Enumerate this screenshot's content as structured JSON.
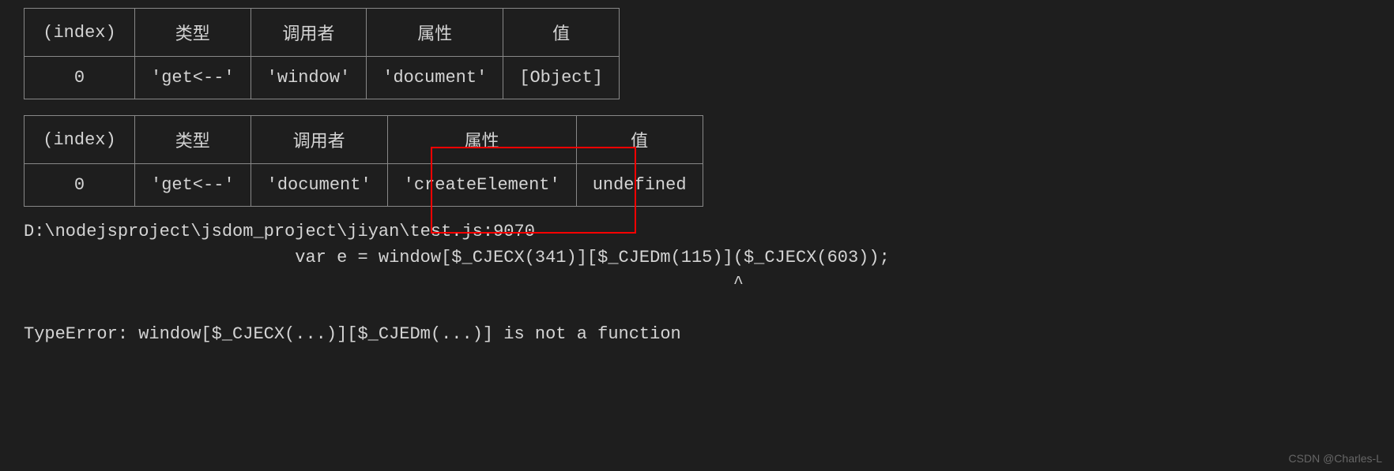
{
  "table1": {
    "headers": [
      "(index)",
      "类型",
      "调用者",
      "属性",
      "值"
    ],
    "row": {
      "index": "0",
      "type": "'get<--'",
      "caller": "'window'",
      "attr": "'document'",
      "value": "[Object]"
    }
  },
  "table2": {
    "headers": [
      "(index)",
      "类型",
      "调用者",
      "属性",
      "值"
    ],
    "row": {
      "index": "0",
      "type": "'get<--'",
      "caller": "'document'",
      "attr": "'createElement'",
      "value": "undefined"
    }
  },
  "output": {
    "path": "D:\\nodejsproject\\jsdom_project\\jiyan\\test.js:9070",
    "code": "                          var e = window[$_CJECX(341)][$_CJEDm(115)]($_CJECX(603));",
    "caret": "                                                                    ^",
    "error": "TypeError: window[$_CJECX(...)][$_CJEDm(...)] is not a function"
  },
  "watermark": "CSDN @Charles-L"
}
